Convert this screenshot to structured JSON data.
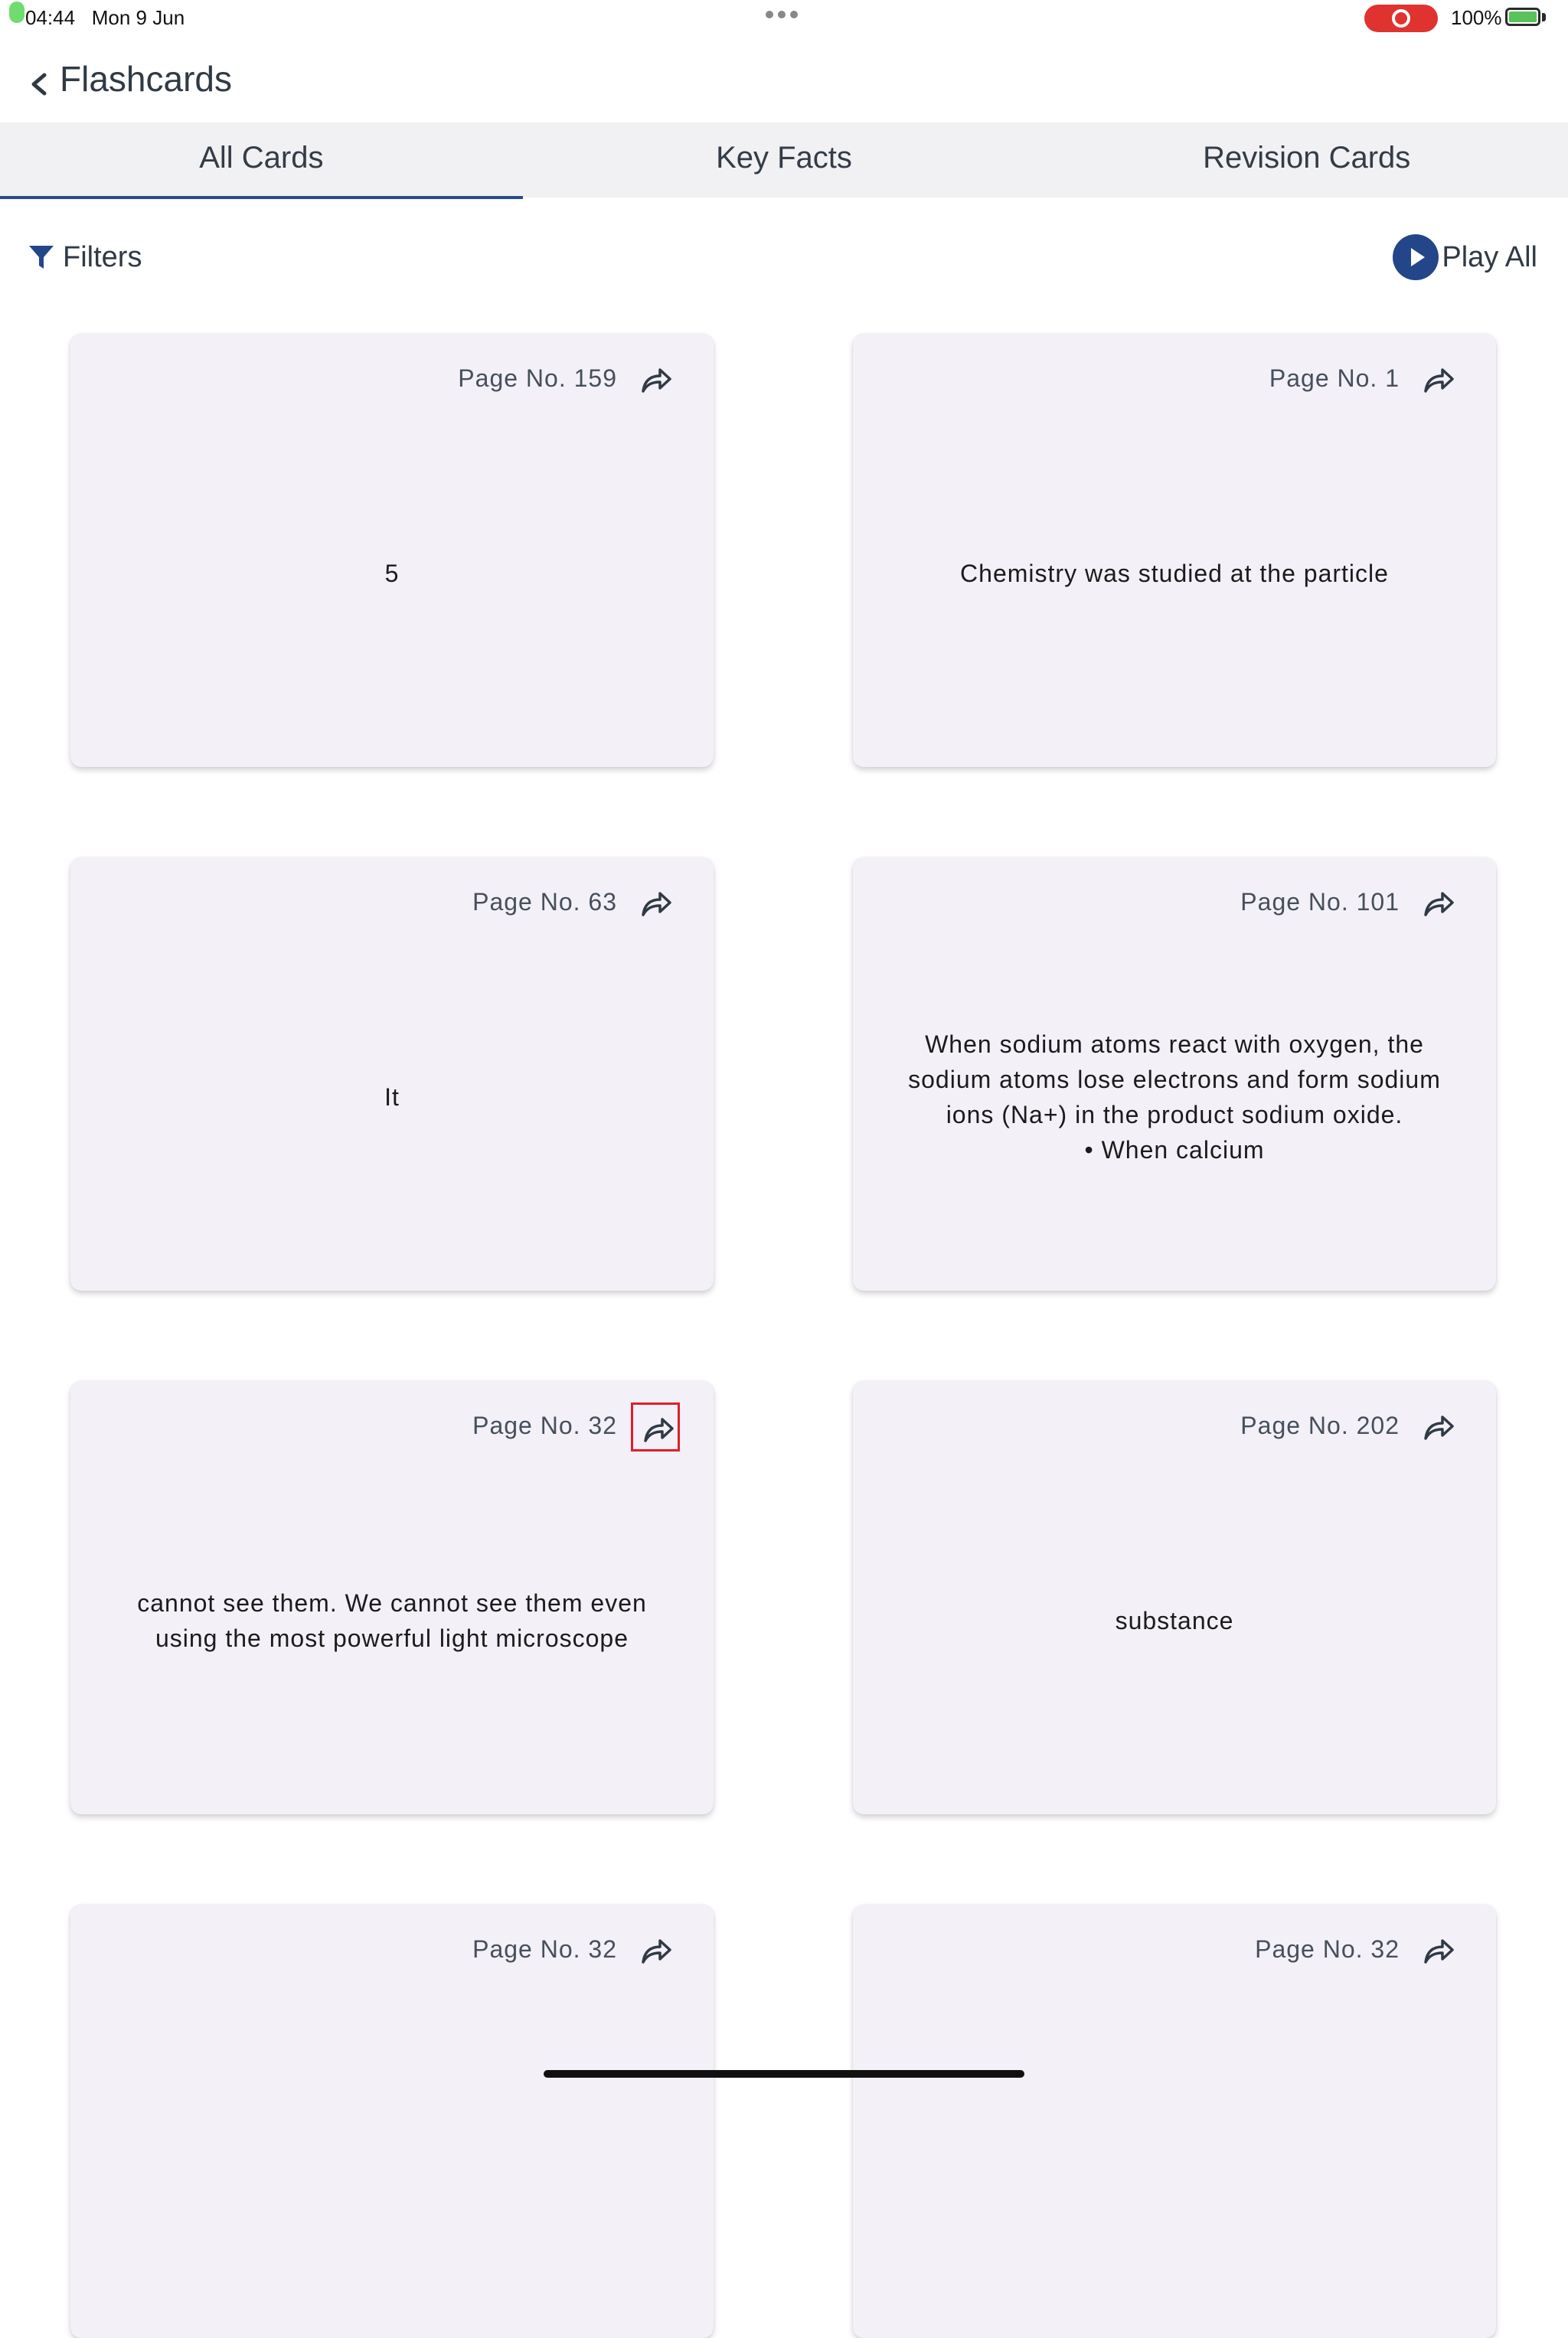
{
  "status_bar": {
    "time": "04:44",
    "date": "Mon 9 Jun",
    "battery": "100%"
  },
  "nav": {
    "title": "Flashcards"
  },
  "tabs": [
    {
      "label": "All Cards",
      "active": true
    },
    {
      "label": "Key Facts",
      "active": false
    },
    {
      "label": "Revision Cards",
      "active": false
    }
  ],
  "toolbar": {
    "filters_label": "Filters",
    "play_all_label": "Play All"
  },
  "cards": [
    {
      "page": "Page No. 159",
      "text": "5"
    },
    {
      "page": "Page No. 1",
      "text": "Chemistry was studied at the particle"
    },
    {
      "page": "Page No. 63",
      "text": "It"
    },
    {
      "page": "Page No. 101",
      "text": "When sodium atoms react with oxygen, the sodium atoms lose electrons and form sodium ions (Na+) in the product sodium oxide.\n•  When calcium"
    },
    {
      "page": "Page No. 32",
      "text": "cannot see them. We cannot see them even using the most powerful light microscope"
    },
    {
      "page": "Page No. 202",
      "text": "substance"
    },
    {
      "page": "Page No. 32",
      "text": ""
    },
    {
      "page": "Page No. 32",
      "text": ""
    }
  ],
  "colors": {
    "accent": "#23468a",
    "card_bg": "#f4f0f8",
    "highlight": "#e01e2a"
  }
}
